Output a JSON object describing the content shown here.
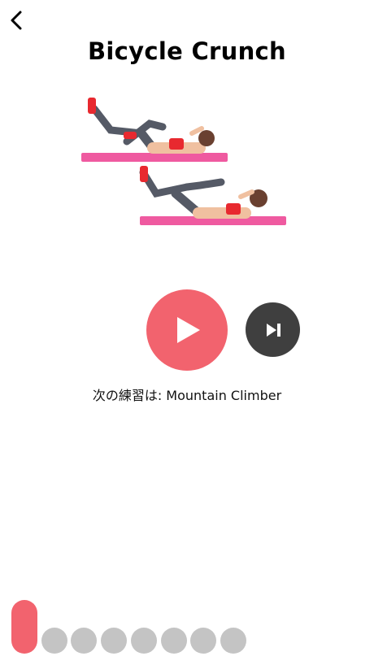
{
  "nav": {
    "back_icon": "chevron-left-icon"
  },
  "exercise": {
    "title": "Bicycle Crunch",
    "image_icon": "bicycle-crunch-illustration"
  },
  "controls": {
    "play_icon": "play-icon",
    "skip_icon": "skip-next-icon",
    "play_color": "#f2636e",
    "skip_color": "#3f3f3f"
  },
  "next": {
    "label": "次の練習は: Mountain Climber"
  },
  "progress": {
    "total_segments": 8,
    "current_segment": 1,
    "active_color": "#f2636e",
    "inactive_color": "#c4c4c4"
  }
}
